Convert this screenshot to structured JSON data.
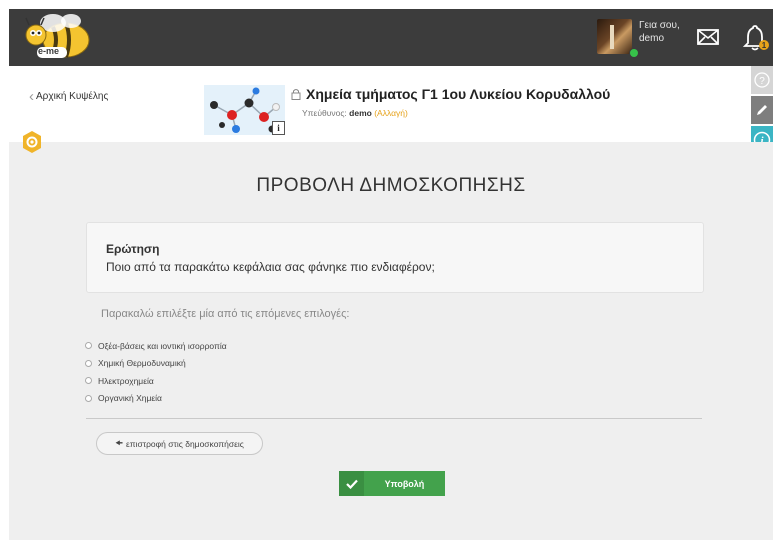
{
  "topbar": {
    "logo_text": "e-me",
    "greeting_line1": "Γεια σου,",
    "greeting_line2": "demo",
    "notification_count": "1"
  },
  "header": {
    "back_label": "Αρχική Κυψέλης",
    "course_title": "Χημεία τμήματος Γ1 1ου Λυκείου Κορυδαλλού",
    "responsible_label": "Υπεύθυνος:",
    "responsible_name": "demo",
    "change_label": "(Αλλαγή)",
    "info_badge": "i"
  },
  "main": {
    "page_title": "ΠΡΟΒΟΛΗ ΔΗΜΟΣΚΟΠΗΣΗΣ",
    "question_label": "Ερώτηση",
    "question_text": "Ποιο από τα παρακάτω κεφάλαια σας φάνηκε πιο ενδιαφέρον;",
    "instruction": "Παρακαλώ επιλέξτε μία από τις επόμενες επιλογές:",
    "options": [
      {
        "label": "Οξέα-βάσεις και ιοντική ισορροπία"
      },
      {
        "label": "Χημική Θερμοδυναμική"
      },
      {
        "label": "Ηλεκτροχημεία"
      },
      {
        "label": "Οργανική Χημεία"
      }
    ],
    "back_button": "επιστροφή στις δημοσκοπήσεις",
    "submit_button": "Υποβολή"
  },
  "colors": {
    "topbar_bg": "#3c3c3c",
    "accent_orange": "#e6a21a",
    "submit_green": "#43a24c",
    "info_teal": "#3bb5c4"
  },
  "icons": [
    "bee-logo",
    "mail-icon",
    "bell-icon",
    "lock-icon",
    "help-icon",
    "pencil-icon",
    "info-icon",
    "gear-icon",
    "check-icon",
    "arrow-left-icon",
    "radio-icon"
  ]
}
